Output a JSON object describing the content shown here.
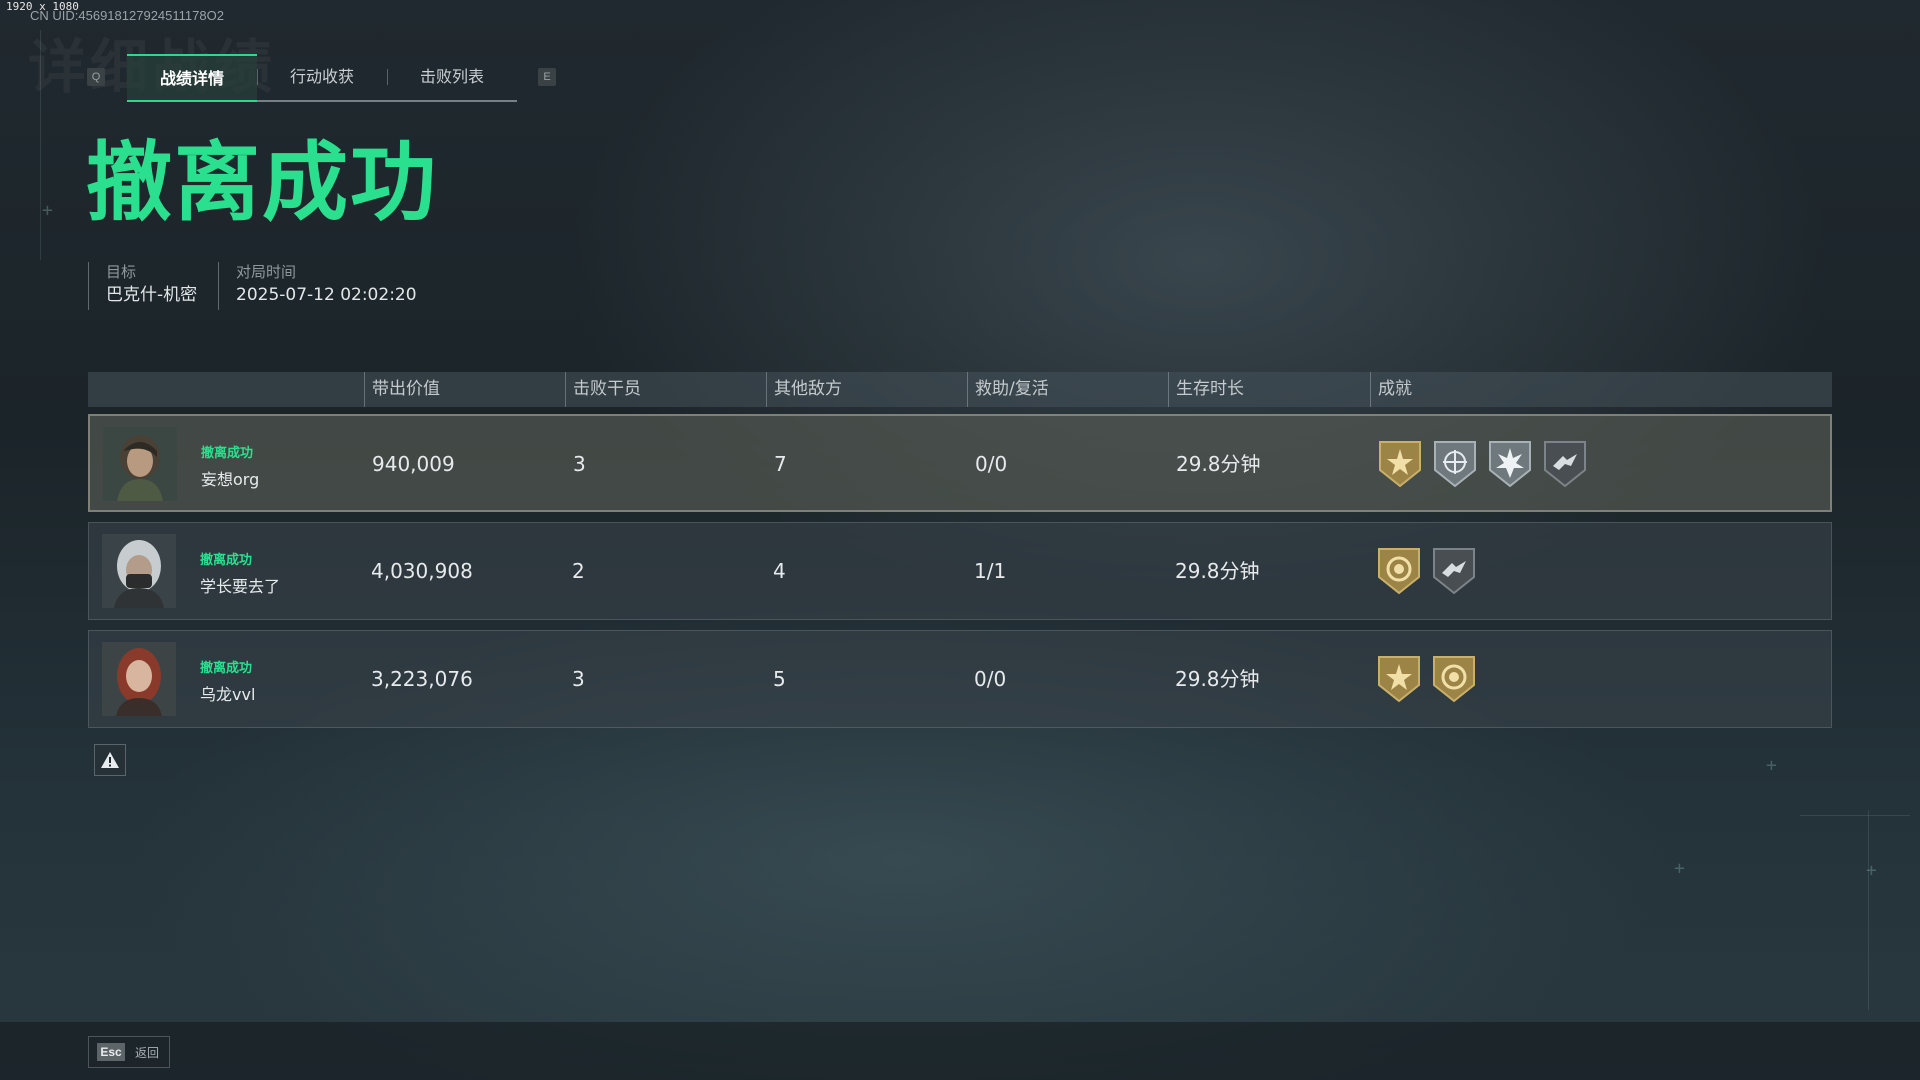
{
  "meta": {
    "resolution": "1920 x 1080",
    "uid": "CN UID:456918127924511178O2",
    "ghost_title": "详细战绩"
  },
  "nav": {
    "prev_key": "Q",
    "next_key": "E"
  },
  "tabs": [
    {
      "label": "战绩详情",
      "active": true
    },
    {
      "label": "行动收获",
      "active": false
    },
    {
      "label": "击败列表",
      "active": false
    }
  ],
  "result": {
    "title": "撤离成功",
    "color": "#2ae08e"
  },
  "info": {
    "target_label": "目标",
    "target_value": "巴克什-机密",
    "time_label": "对局时间",
    "time_value": "2025-07-12 02:02:20"
  },
  "table": {
    "columns": [
      "带出价值",
      "击败干员",
      "其他敌方",
      "救助/复活",
      "生存时长",
      "成就"
    ],
    "rows": [
      {
        "status": "撤离成功",
        "name": "妄想org",
        "value": "940,009",
        "defeated_operators": "3",
        "other_enemies": "7",
        "rescue_revive": "0/0",
        "survival": "29.8分钟",
        "badges": [
          "gold-star-badge-icon",
          "silver-crosshair-badge-icon",
          "silver-burst-badge-icon",
          "dark-wings-badge-icon"
        ]
      },
      {
        "status": "撤离成功",
        "name": "学长要去了",
        "value": "4,030,908",
        "defeated_operators": "2",
        "other_enemies": "4",
        "rescue_revive": "1/1",
        "survival": "29.8分钟",
        "badges": [
          "gold-coin-badge-icon",
          "dark-wings-badge-icon"
        ]
      },
      {
        "status": "撤离成功",
        "name": "乌龙vvl",
        "value": "3,223,076",
        "defeated_operators": "3",
        "other_enemies": "5",
        "rescue_revive": "0/0",
        "survival": "29.8分钟",
        "badges": [
          "gold-star-badge-icon",
          "gold-coin-badge-icon"
        ]
      }
    ]
  },
  "footer": {
    "esc_key": "Esc",
    "esc_label": "返回"
  },
  "colors": {
    "accent": "#2ae08e",
    "gold_badge": "#b59a52",
    "silver_badge": "#8d979c",
    "dark_badge": "#585e62"
  }
}
